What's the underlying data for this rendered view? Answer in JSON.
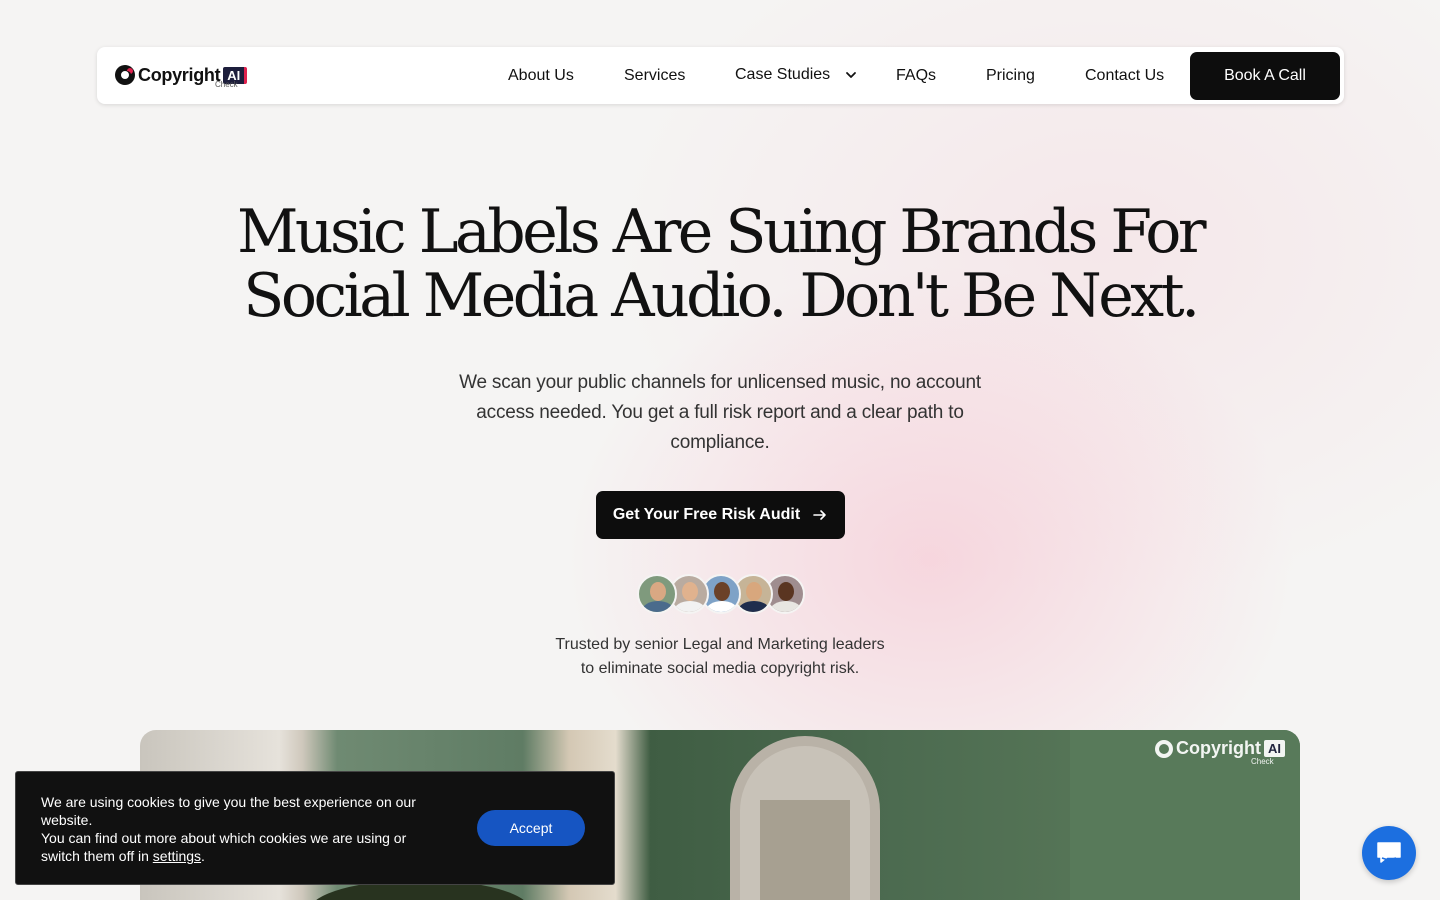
{
  "nav": {
    "logo_text": "Copyright",
    "logo_badge": "AI",
    "logo_sub": "Check",
    "links": {
      "about": "About Us",
      "services": "Services",
      "case_studies": "Case Studies",
      "faqs": "FAQs",
      "pricing": "Pricing",
      "contact": "Contact Us"
    },
    "book_call": "Book A Call"
  },
  "hero": {
    "title_line1": "Music Labels Are Suing Brands For",
    "title_line2": "Social Media Audio. Don't Be Next.",
    "subtitle": "We scan your public channels for unlicensed music, no account access needed. You get a full risk report and a clear path to compliance.",
    "cta": "Get Your Free Risk Audit",
    "trusted_line1": "Trusted by senior Legal and Marketing leaders",
    "trusted_line2": "to eliminate social media copyright risk."
  },
  "avatars": [
    {
      "icon": "avatar-1",
      "bg": "#7f9a7d",
      "skin": "#d9a883",
      "shirt": "#4a6b8c"
    },
    {
      "icon": "avatar-2",
      "bg": "#b9aba0",
      "skin": "#e0b28e",
      "shirt": "#f2f2f2"
    },
    {
      "icon": "avatar-3",
      "bg": "#7ea2c7",
      "skin": "#6b4128",
      "shirt": "#ffffff"
    },
    {
      "icon": "avatar-4",
      "bg": "#c6b497",
      "skin": "#d8a77d",
      "shirt": "#1f2d4d"
    },
    {
      "icon": "avatar-5",
      "bg": "#9f8d8f",
      "skin": "#5a3521",
      "shirt": "#e8e6e2"
    }
  ],
  "media": {
    "logo_text": "Copyright",
    "logo_badge": "AI",
    "logo_sub": "Check"
  },
  "cookie": {
    "line1": "We are using cookies to give you the best experience on our website.",
    "line2_prefix": "You can find out more about which cookies we are using or switch them off in ",
    "settings_link": "settings",
    "line2_suffix": ".",
    "accept": "Accept"
  },
  "colors": {
    "accent_dark": "#0d0d0d",
    "accept_blue": "#1655c2",
    "chat_blue": "#1c6fe0",
    "brand_red": "#e0224e"
  }
}
